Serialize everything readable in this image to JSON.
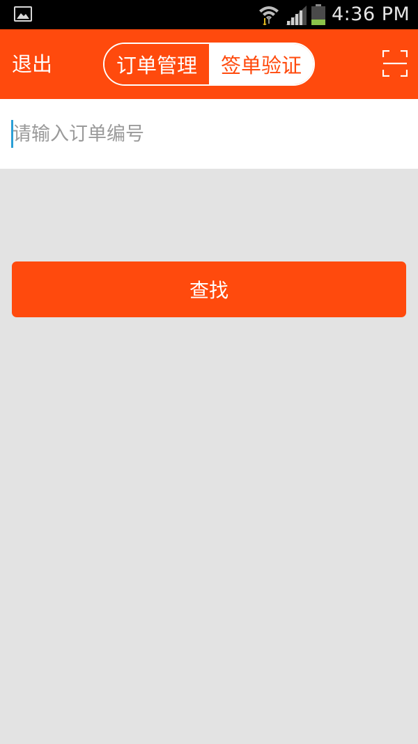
{
  "status_bar": {
    "time": "4:36 PM",
    "icons": [
      "gallery-icon",
      "wifi-icon",
      "signal-icon",
      "battery-icon"
    ],
    "battery_level": 0.3
  },
  "header": {
    "exit_label": "退出",
    "tabs": [
      {
        "label": "订单管理",
        "selected": false
      },
      {
        "label": "签单验证",
        "selected": true
      }
    ],
    "scan_icon": "scan-icon"
  },
  "search": {
    "placeholder": "请输入订单编号",
    "value": "",
    "button_label": "查找"
  },
  "colors": {
    "accent": "#ff4a0d",
    "background": "#e3e3e3",
    "caret": "#2a9fd6"
  }
}
